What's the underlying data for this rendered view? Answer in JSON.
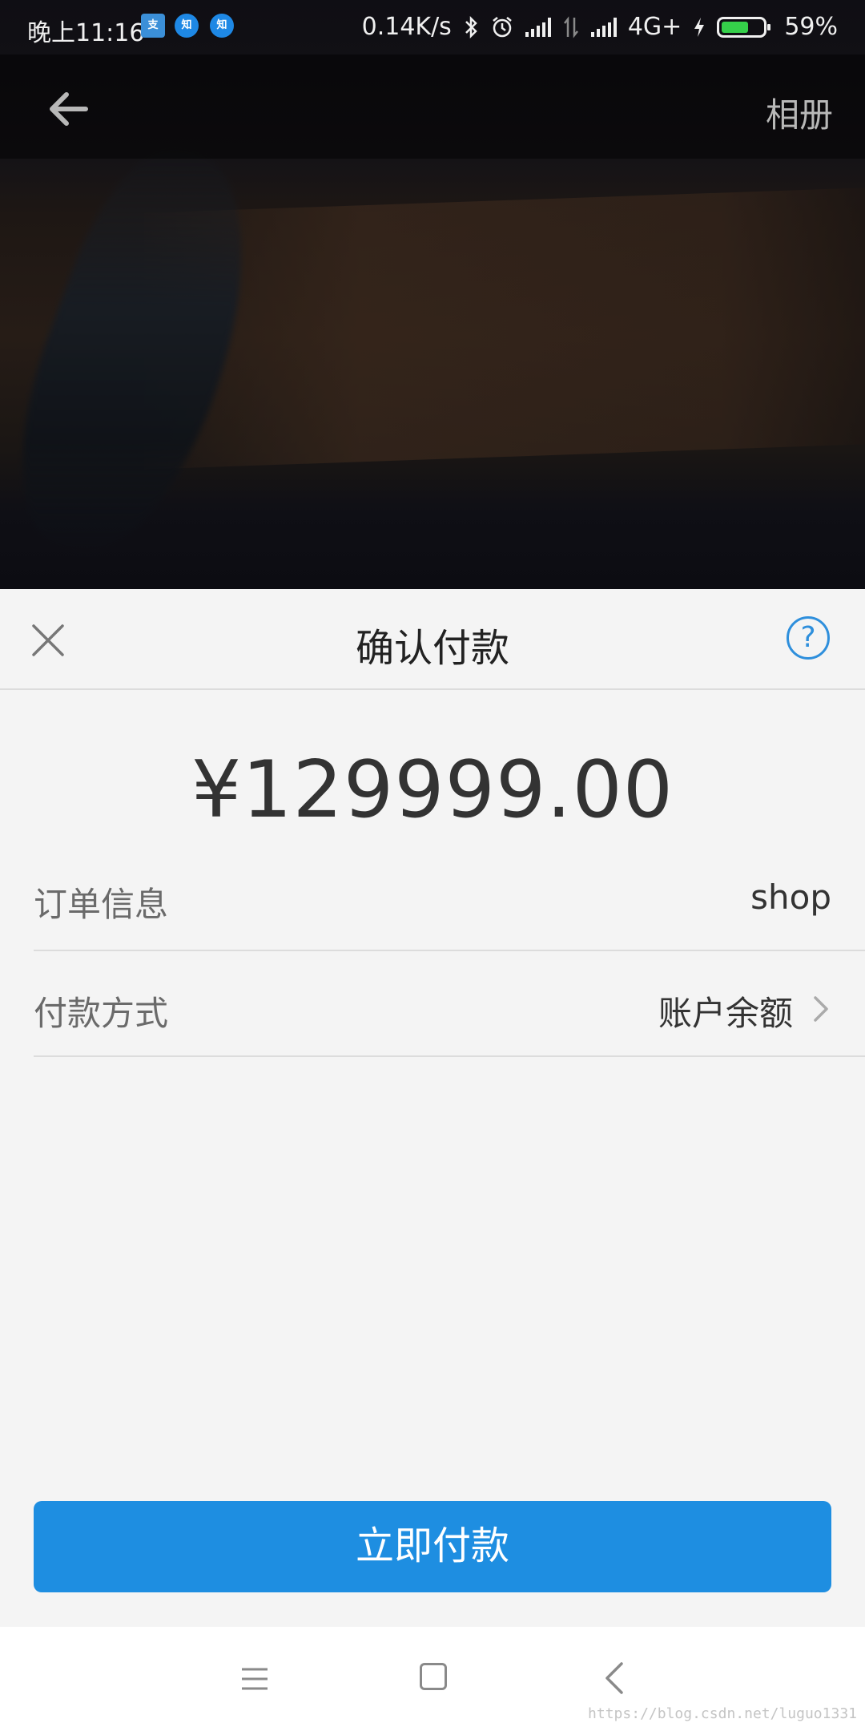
{
  "status_bar": {
    "time": "晚上11:16",
    "app_icons": [
      "支",
      "知",
      "知"
    ],
    "network_speed": "0.14K/s",
    "network_type": "4G+",
    "battery_percent": "59%",
    "battery_level": 0.59
  },
  "scanner": {
    "album_label": "相册"
  },
  "payment_sheet": {
    "title": "确认付款",
    "help_symbol": "?",
    "amount": "¥129999.00",
    "order_info": {
      "label": "订单信息",
      "value": "shop"
    },
    "payment_method": {
      "label": "付款方式",
      "value": "账户余额"
    },
    "pay_button_label": "立即付款"
  },
  "watermark": "https://blog.csdn.net/luguo1331",
  "colors": {
    "accent": "#1e8ee1",
    "sheet_background": "#f4f4f4",
    "battery_fill": "#35d04a"
  }
}
